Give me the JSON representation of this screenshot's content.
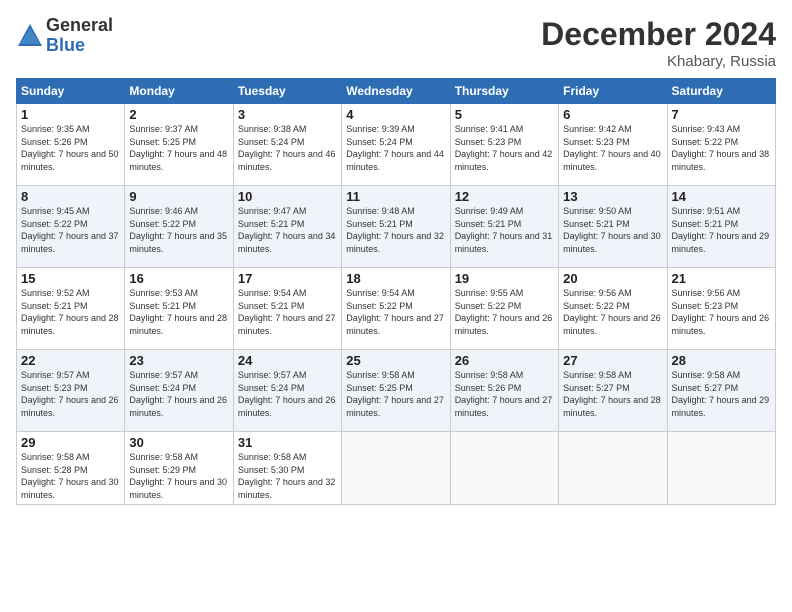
{
  "logo": {
    "general": "General",
    "blue": "Blue"
  },
  "title": {
    "month_year": "December 2024",
    "location": "Khabary, Russia"
  },
  "headers": [
    "Sunday",
    "Monday",
    "Tuesday",
    "Wednesday",
    "Thursday",
    "Friday",
    "Saturday"
  ],
  "weeks": [
    [
      {
        "day": "1",
        "sunrise": "Sunrise: 9:35 AM",
        "sunset": "Sunset: 5:26 PM",
        "daylight": "Daylight: 7 hours and 50 minutes."
      },
      {
        "day": "2",
        "sunrise": "Sunrise: 9:37 AM",
        "sunset": "Sunset: 5:25 PM",
        "daylight": "Daylight: 7 hours and 48 minutes."
      },
      {
        "day": "3",
        "sunrise": "Sunrise: 9:38 AM",
        "sunset": "Sunset: 5:24 PM",
        "daylight": "Daylight: 7 hours and 46 minutes."
      },
      {
        "day": "4",
        "sunrise": "Sunrise: 9:39 AM",
        "sunset": "Sunset: 5:24 PM",
        "daylight": "Daylight: 7 hours and 44 minutes."
      },
      {
        "day": "5",
        "sunrise": "Sunrise: 9:41 AM",
        "sunset": "Sunset: 5:23 PM",
        "daylight": "Daylight: 7 hours and 42 minutes."
      },
      {
        "day": "6",
        "sunrise": "Sunrise: 9:42 AM",
        "sunset": "Sunset: 5:23 PM",
        "daylight": "Daylight: 7 hours and 40 minutes."
      },
      {
        "day": "7",
        "sunrise": "Sunrise: 9:43 AM",
        "sunset": "Sunset: 5:22 PM",
        "daylight": "Daylight: 7 hours and 38 minutes."
      }
    ],
    [
      {
        "day": "8",
        "sunrise": "Sunrise: 9:45 AM",
        "sunset": "Sunset: 5:22 PM",
        "daylight": "Daylight: 7 hours and 37 minutes."
      },
      {
        "day": "9",
        "sunrise": "Sunrise: 9:46 AM",
        "sunset": "Sunset: 5:22 PM",
        "daylight": "Daylight: 7 hours and 35 minutes."
      },
      {
        "day": "10",
        "sunrise": "Sunrise: 9:47 AM",
        "sunset": "Sunset: 5:21 PM",
        "daylight": "Daylight: 7 hours and 34 minutes."
      },
      {
        "day": "11",
        "sunrise": "Sunrise: 9:48 AM",
        "sunset": "Sunset: 5:21 PM",
        "daylight": "Daylight: 7 hours and 32 minutes."
      },
      {
        "day": "12",
        "sunrise": "Sunrise: 9:49 AM",
        "sunset": "Sunset: 5:21 PM",
        "daylight": "Daylight: 7 hours and 31 minutes."
      },
      {
        "day": "13",
        "sunrise": "Sunrise: 9:50 AM",
        "sunset": "Sunset: 5:21 PM",
        "daylight": "Daylight: 7 hours and 30 minutes."
      },
      {
        "day": "14",
        "sunrise": "Sunrise: 9:51 AM",
        "sunset": "Sunset: 5:21 PM",
        "daylight": "Daylight: 7 hours and 29 minutes."
      }
    ],
    [
      {
        "day": "15",
        "sunrise": "Sunrise: 9:52 AM",
        "sunset": "Sunset: 5:21 PM",
        "daylight": "Daylight: 7 hours and 28 minutes."
      },
      {
        "day": "16",
        "sunrise": "Sunrise: 9:53 AM",
        "sunset": "Sunset: 5:21 PM",
        "daylight": "Daylight: 7 hours and 28 minutes."
      },
      {
        "day": "17",
        "sunrise": "Sunrise: 9:54 AM",
        "sunset": "Sunset: 5:21 PM",
        "daylight": "Daylight: 7 hours and 27 minutes."
      },
      {
        "day": "18",
        "sunrise": "Sunrise: 9:54 AM",
        "sunset": "Sunset: 5:22 PM",
        "daylight": "Daylight: 7 hours and 27 minutes."
      },
      {
        "day": "19",
        "sunrise": "Sunrise: 9:55 AM",
        "sunset": "Sunset: 5:22 PM",
        "daylight": "Daylight: 7 hours and 26 minutes."
      },
      {
        "day": "20",
        "sunrise": "Sunrise: 9:56 AM",
        "sunset": "Sunset: 5:22 PM",
        "daylight": "Daylight: 7 hours and 26 minutes."
      },
      {
        "day": "21",
        "sunrise": "Sunrise: 9:56 AM",
        "sunset": "Sunset: 5:23 PM",
        "daylight": "Daylight: 7 hours and 26 minutes."
      }
    ],
    [
      {
        "day": "22",
        "sunrise": "Sunrise: 9:57 AM",
        "sunset": "Sunset: 5:23 PM",
        "daylight": "Daylight: 7 hours and 26 minutes."
      },
      {
        "day": "23",
        "sunrise": "Sunrise: 9:57 AM",
        "sunset": "Sunset: 5:24 PM",
        "daylight": "Daylight: 7 hours and 26 minutes."
      },
      {
        "day": "24",
        "sunrise": "Sunrise: 9:57 AM",
        "sunset": "Sunset: 5:24 PM",
        "daylight": "Daylight: 7 hours and 26 minutes."
      },
      {
        "day": "25",
        "sunrise": "Sunrise: 9:58 AM",
        "sunset": "Sunset: 5:25 PM",
        "daylight": "Daylight: 7 hours and 27 minutes."
      },
      {
        "day": "26",
        "sunrise": "Sunrise: 9:58 AM",
        "sunset": "Sunset: 5:26 PM",
        "daylight": "Daylight: 7 hours and 27 minutes."
      },
      {
        "day": "27",
        "sunrise": "Sunrise: 9:58 AM",
        "sunset": "Sunset: 5:27 PM",
        "daylight": "Daylight: 7 hours and 28 minutes."
      },
      {
        "day": "28",
        "sunrise": "Sunrise: 9:58 AM",
        "sunset": "Sunset: 5:27 PM",
        "daylight": "Daylight: 7 hours and 29 minutes."
      }
    ],
    [
      {
        "day": "29",
        "sunrise": "Sunrise: 9:58 AM",
        "sunset": "Sunset: 5:28 PM",
        "daylight": "Daylight: 7 hours and 30 minutes."
      },
      {
        "day": "30",
        "sunrise": "Sunrise: 9:58 AM",
        "sunset": "Sunset: 5:29 PM",
        "daylight": "Daylight: 7 hours and 30 minutes."
      },
      {
        "day": "31",
        "sunrise": "Sunrise: 9:58 AM",
        "sunset": "Sunset: 5:30 PM",
        "daylight": "Daylight: 7 hours and 32 minutes."
      },
      null,
      null,
      null,
      null
    ]
  ]
}
